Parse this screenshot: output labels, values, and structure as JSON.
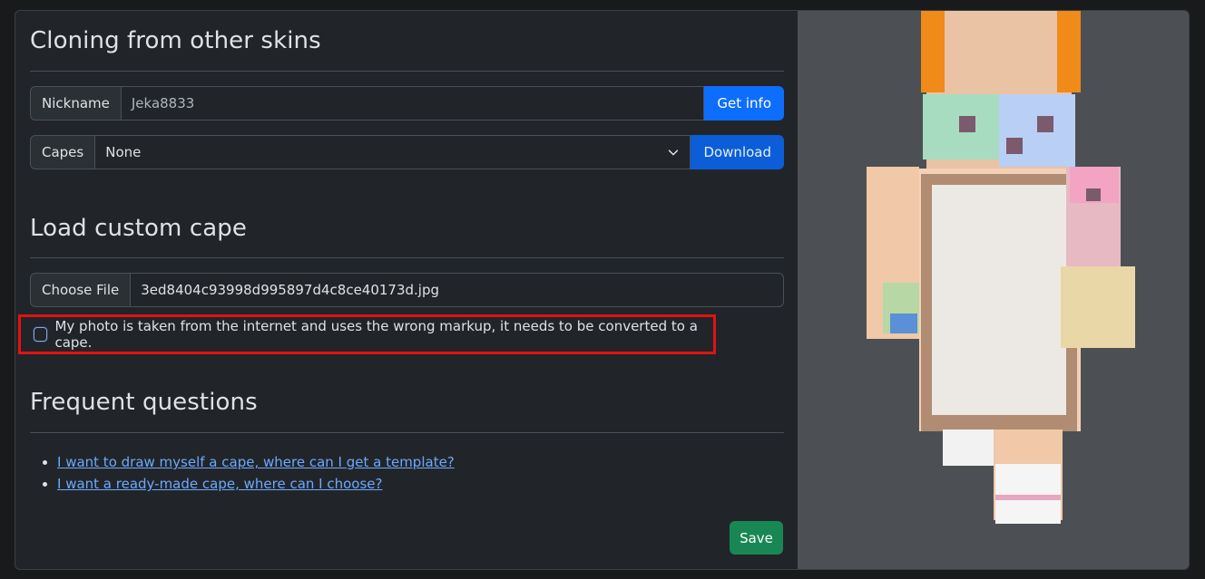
{
  "cloning": {
    "title": "Cloning from other skins",
    "nickname_label": "Nickname",
    "nickname_value": "Jeka8833",
    "get_info_label": "Get info",
    "capes_label": "Capes",
    "capes_selected": "None",
    "download_label": "Download"
  },
  "custom_cape": {
    "title": "Load custom cape",
    "choose_file_label": "Choose File",
    "file_name": "3ed8404c93998d995897d4c8ce40173d.jpg",
    "convert_checkbox_label": "My photo is taken from the internet and uses the wrong markup, it needs to be converted to a cape.",
    "convert_checked": false
  },
  "faq": {
    "title": "Frequent questions",
    "items": [
      "I want to draw myself a cape, where can I get a template?",
      "I want a ready-made cape, where can I choose?"
    ]
  },
  "save_label": "Save",
  "colors": {
    "primary": "#0d6efd",
    "success": "#198754",
    "highlight": "#e31111",
    "preview_bg": "#4c5054"
  }
}
